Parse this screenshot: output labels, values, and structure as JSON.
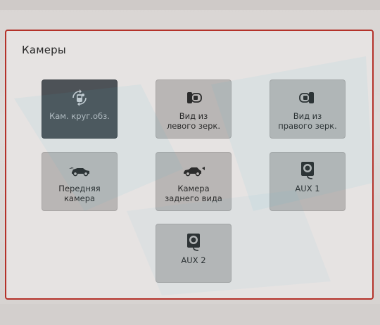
{
  "panel": {
    "title": "Камеры"
  },
  "tiles": [
    {
      "label": "Кам. круг.обз.",
      "icon": "surround-camera-icon",
      "active": true
    },
    {
      "label": "Вид из\nлевого зерк.",
      "icon": "left-mirror-icon",
      "active": false
    },
    {
      "label": "Вид из\nправого зерк.",
      "icon": "right-mirror-icon",
      "active": false
    },
    {
      "label": "Передняя\nкамера",
      "icon": "front-car-icon",
      "active": false
    },
    {
      "label": "Камера\nзаднего вида",
      "icon": "rear-car-icon",
      "active": false
    },
    {
      "label": "AUX 1",
      "icon": "aux-device-icon",
      "active": false
    },
    {
      "label": "AUX 2",
      "icon": "aux-device-icon",
      "active": false
    }
  ],
  "colors": {
    "accent_border": "#b4322a",
    "active_tile": "#4d5257",
    "tile": "#b9b6b5"
  }
}
